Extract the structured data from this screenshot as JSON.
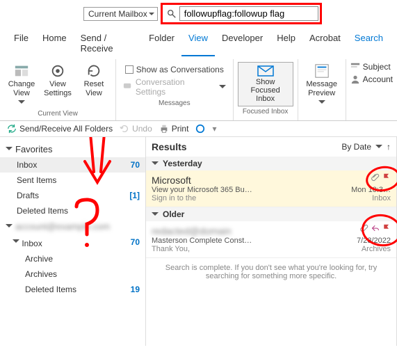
{
  "top": {
    "mailbox_dropdown": "Current Mailbox",
    "search_value": "followupflag:followup flag"
  },
  "menu": {
    "file": "File",
    "home": "Home",
    "send_receive": "Send / Receive",
    "folder": "Folder",
    "view": "View",
    "developer": "Developer",
    "help": "Help",
    "acrobat": "Acrobat",
    "search": "Search"
  },
  "ribbon": {
    "change_view": "Change View",
    "view_settings": "View Settings",
    "reset_view": "Reset View",
    "current_view_label": "Current View",
    "show_conversations": "Show as Conversations",
    "conversation_settings": "Conversation Settings",
    "messages_label": "Messages",
    "show_focused_inbox": "Show Focused Inbox",
    "focused_inbox_label": "Focused Inbox",
    "message_preview": "Message Preview",
    "subject": "Subject",
    "account": "Account"
  },
  "quick": {
    "send_receive_all": "Send/Receive All Folders",
    "undo": "Undo",
    "print": "Print"
  },
  "nav": {
    "favorites_label": "Favorites",
    "folders": [
      {
        "name": "Inbox",
        "count": "70",
        "selected": true
      },
      {
        "name": "Sent Items",
        "count": ""
      },
      {
        "name": "Drafts",
        "count": "[1]"
      },
      {
        "name": "Deleted Items",
        "count": ""
      }
    ],
    "account_label_blur": "account@example.com",
    "sub_folders": [
      {
        "name": "Inbox",
        "count": "70"
      },
      {
        "name": "Archive",
        "count": ""
      },
      {
        "name": "Archives",
        "count": ""
      },
      {
        "name": "Deleted Items",
        "count": "19"
      }
    ]
  },
  "results": {
    "title": "Results",
    "sort_label": "By Date",
    "group_yesterday": "Yesterday",
    "group_older": "Older",
    "mails": [
      {
        "from": "Microsoft",
        "subject": "View your Microsoft 365 Bu…",
        "time": "Mon 10:3…",
        "preview": "Sign in to the",
        "folder": "Inbox"
      },
      {
        "from": "redacted@domain",
        "subject": "Masterson Complete Const…",
        "time": "7/23/2022",
        "preview": "Thank You,",
        "folder": "Archives"
      }
    ],
    "search_complete": "Search is complete. If you don't see what you're looking for, try searching for something more specific."
  }
}
